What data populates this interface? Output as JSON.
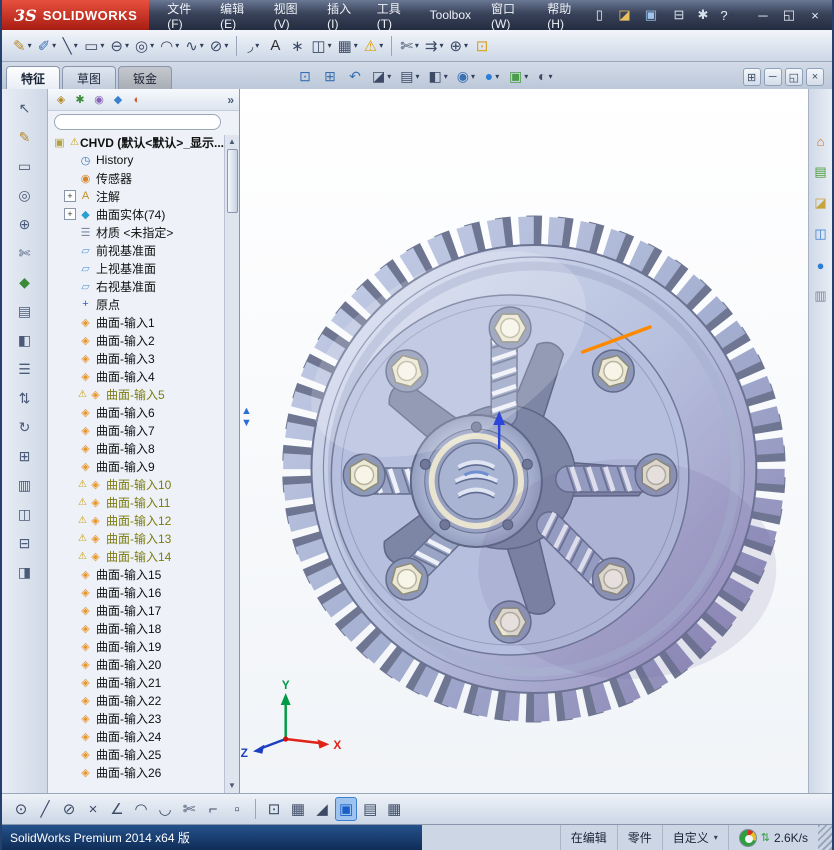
{
  "window": {
    "logo_mark": "3S",
    "logo_text": "SOLIDWORKS"
  },
  "menubar": {
    "items": [
      {
        "name": "menu-file",
        "label": "文件(F)"
      },
      {
        "name": "menu-edit",
        "label": "编辑(E)"
      },
      {
        "name": "menu-view",
        "label": "视图(V)"
      },
      {
        "name": "menu-insert",
        "label": "插入(I)"
      },
      {
        "name": "menu-tools",
        "label": "工具(T)"
      },
      {
        "name": "menu-toolbox",
        "label": "Toolbox"
      },
      {
        "name": "menu-window",
        "label": "窗口(W)"
      },
      {
        "name": "menu-help",
        "label": "帮助(H)"
      }
    ],
    "quick_icons": [
      {
        "name": "new-document-icon",
        "glyph": "▯",
        "caret": true
      },
      {
        "name": "open-icon",
        "glyph": "◪",
        "color": "#e8c060",
        "caret": true
      },
      {
        "name": "save-icon",
        "glyph": "▣",
        "color": "#9ec4ee",
        "caret": true
      },
      {
        "name": "print-icon",
        "glyph": "⊟",
        "color": "#d8e0ec"
      },
      {
        "name": "options-icon",
        "glyph": "✱",
        "color": "#d8e0ec"
      },
      {
        "name": "help-icon",
        "glyph": "?",
        "caret": true
      }
    ],
    "window_icons": [
      {
        "name": "minimize-button",
        "glyph": "─"
      },
      {
        "name": "restore-button",
        "glyph": "◱"
      },
      {
        "name": "close-button",
        "glyph": "×"
      }
    ]
  },
  "sketch_toolbar": [
    {
      "name": "sketch-icon",
      "glyph": "✎",
      "color": "#b5882a",
      "caret": true
    },
    {
      "name": "smart-dimension-icon",
      "glyph": "✐",
      "color": "#3a6fb0",
      "caret": true
    },
    {
      "name": "line-icon",
      "glyph": "╲",
      "caret": true
    },
    {
      "name": "rectangle-icon",
      "glyph": "▭",
      "caret": true
    },
    {
      "name": "slot-icon",
      "glyph": "⊖",
      "caret": true
    },
    {
      "name": "circle-icon",
      "glyph": "◎",
      "caret": true
    },
    {
      "name": "arc-icon",
      "glyph": "◠",
      "caret": true
    },
    {
      "name": "spline-icon",
      "glyph": "∿",
      "caret": true
    },
    {
      "name": "ellipse-icon",
      "glyph": "⊘",
      "caret": true
    },
    {
      "sep": true
    },
    {
      "name": "sketch-fillet-icon",
      "glyph": "◞",
      "caret": true
    },
    {
      "name": "text-icon",
      "glyph": "A",
      "color": "#303030"
    },
    {
      "name": "point-icon",
      "glyph": "∗"
    },
    {
      "name": "mirror-entities-icon",
      "glyph": "◫",
      "caret": true
    },
    {
      "name": "linear-pattern-icon",
      "glyph": "▦",
      "caret": true
    },
    {
      "name": "display-relations-icon",
      "glyph": "⚠",
      "color": "#d8a000",
      "caret": true
    },
    {
      "sep": true
    },
    {
      "name": "trim-entities-icon",
      "glyph": "✄",
      "caret": true
    },
    {
      "name": "offset-entities-icon",
      "glyph": "⇉",
      "caret": true
    },
    {
      "name": "convert-entities-icon",
      "glyph": "⊕",
      "caret": true
    },
    {
      "name": "instant2d-icon",
      "glyph": "⊡",
      "color": "#d8a020"
    }
  ],
  "command_tabs": [
    {
      "name": "tab-features",
      "label": "特征",
      "active": true
    },
    {
      "name": "tab-sketch",
      "label": "草图"
    },
    {
      "name": "tab-sheet-metal",
      "label": "钣金",
      "variant": "dark"
    }
  ],
  "hud_toolbar": [
    {
      "name": "zoom-fit-icon",
      "glyph": "⊡",
      "color": "#3a6fb0"
    },
    {
      "name": "zoom-to-area-icon",
      "glyph": "⊞",
      "color": "#3a6fb0"
    },
    {
      "name": "previous-view-icon",
      "glyph": "↶",
      "color": "#3a6fb0"
    },
    {
      "name": "section-view-icon",
      "glyph": "◪",
      "caret": true
    },
    {
      "name": "view-orientation-icon",
      "glyph": "▤",
      "caret": true
    },
    {
      "name": "display-style-icon",
      "glyph": "◧",
      "caret": true
    },
    {
      "name": "hide-show-items-icon",
      "glyph": "◉",
      "color": "#3a6fb0",
      "caret": true
    },
    {
      "name": "edit-appearance-icon",
      "glyph": "●",
      "color": "#2a7fd8",
      "caret": true
    },
    {
      "name": "apply-scene-icon",
      "glyph": "▣",
      "color": "#4a9e4a",
      "caret": true
    },
    {
      "name": "view-settings-icon",
      "glyph": "◐",
      "caret": true
    }
  ],
  "doc_window_icons": [
    {
      "name": "tile-windows-icon",
      "glyph": "⊞"
    },
    {
      "name": "doc-minimize-icon",
      "glyph": "─"
    },
    {
      "name": "doc-restore-icon",
      "glyph": "◱"
    },
    {
      "name": "doc-close-icon",
      "glyph": "×"
    }
  ],
  "left_toolbar": [
    {
      "name": "left-toolbar-icon",
      "glyph": "↖"
    },
    {
      "name": "left-toolbar-icon",
      "glyph": "✎",
      "color": "#b5882a"
    },
    {
      "name": "left-toolbar-icon",
      "glyph": "▭"
    },
    {
      "name": "left-toolbar-icon",
      "glyph": "◎"
    },
    {
      "name": "left-toolbar-icon",
      "glyph": "⊕"
    },
    {
      "name": "left-toolbar-icon",
      "glyph": "✄"
    },
    {
      "name": "left-toolbar-icon",
      "glyph": "◆",
      "color": "#3a8a3a"
    },
    {
      "name": "left-toolbar-icon",
      "glyph": "▤"
    },
    {
      "name": "left-toolbar-icon",
      "glyph": "◧"
    },
    {
      "name": "left-toolbar-icon",
      "glyph": "☰"
    },
    {
      "name": "left-toolbar-icon",
      "glyph": "⇅"
    },
    {
      "name": "left-toolbar-icon",
      "glyph": "↻"
    },
    {
      "name": "left-toolbar-icon",
      "glyph": "⊞"
    },
    {
      "name": "left-toolbar-icon",
      "glyph": "▥"
    },
    {
      "name": "left-toolbar-icon",
      "glyph": "◫"
    },
    {
      "name": "left-toolbar-icon",
      "glyph": "⊟"
    },
    {
      "name": "left-toolbar-icon",
      "glyph": "◨"
    }
  ],
  "tree_tabs": [
    {
      "name": "featuremanager-tab-icon",
      "glyph": "◈",
      "color": "#b5892a"
    },
    {
      "name": "propertymanager-tab-icon",
      "glyph": "✱",
      "color": "#3a8a3a"
    },
    {
      "name": "configurationmanager-tab-icon",
      "glyph": "◉",
      "color": "#8a62b8"
    },
    {
      "name": "dimxpert-tab-icon",
      "glyph": "◆",
      "color": "#3a7fd0"
    },
    {
      "name": "displaymanager-tab-icon",
      "glyph": "◐",
      "color": "#d05a3a"
    }
  ],
  "tree": {
    "root_label": "CHVD (默认<默认>_显示...",
    "expand_chevrons": "»",
    "icon_glyphs": {
      "part": {
        "glyph": "▣",
        "color": "#b5a23c"
      },
      "warning": {
        "glyph": "⚠",
        "color": "#c89b00"
      },
      "history": {
        "glyph": "◷",
        "color": "#3a6fb0"
      },
      "sensors": {
        "glyph": "◉",
        "color": "#d8842a"
      },
      "annotations": {
        "glyph": "A",
        "color": "#c09020"
      },
      "surface-bodies": {
        "glyph": "◆",
        "color": "#2a9fd0"
      },
      "material": {
        "glyph": "☰",
        "color": "#7a8aa0"
      },
      "plane": {
        "glyph": "▱",
        "color": "#5a9ad8"
      },
      "origin": {
        "glyph": "+",
        "color": "#2a5fd0"
      },
      "surface-import": {
        "glyph": "◈",
        "color": "#e8952a"
      }
    },
    "items": [
      {
        "icon": "history",
        "label": "History"
      },
      {
        "icon": "sensors",
        "label": "传感器"
      },
      {
        "icon": "annotations",
        "label": "注解",
        "expand": true
      },
      {
        "icon": "surface-bodies",
        "label": "曲面实体(74)",
        "expand": true
      },
      {
        "icon": "material",
        "label": "材质 <未指定>"
      },
      {
        "icon": "plane",
        "label": "前视基准面"
      },
      {
        "icon": "plane",
        "label": "上视基准面"
      },
      {
        "icon": "plane",
        "label": "右视基准面"
      },
      {
        "icon": "origin",
        "label": "原点"
      },
      {
        "icon": "surface-import",
        "label": "曲面-输入1"
      },
      {
        "icon": "surface-import",
        "label": "曲面-输入2"
      },
      {
        "icon": "surface-import",
        "label": "曲面-输入3"
      },
      {
        "icon": "surface-import",
        "label": "曲面-输入4"
      },
      {
        "icon": "surface-import",
        "label": "曲面-输入5",
        "warning": true
      },
      {
        "icon": "surface-import",
        "label": "曲面-输入6"
      },
      {
        "icon": "surface-import",
        "label": "曲面-输入7"
      },
      {
        "icon": "surface-import",
        "label": "曲面-输入8"
      },
      {
        "icon": "surface-import",
        "label": "曲面-输入9"
      },
      {
        "icon": "surface-import",
        "label": "曲面-输入10",
        "warning": true
      },
      {
        "icon": "surface-import",
        "label": "曲面-输入11",
        "warning": true
      },
      {
        "icon": "surface-import",
        "label": "曲面-输入12",
        "warning": true
      },
      {
        "icon": "surface-import",
        "label": "曲面-输入13",
        "warning": true
      },
      {
        "icon": "surface-import",
        "label": "曲面-输入14",
        "warning": true
      },
      {
        "icon": "surface-import",
        "label": "曲面-输入15"
      },
      {
        "icon": "surface-import",
        "label": "曲面-输入16"
      },
      {
        "icon": "surface-import",
        "label": "曲面-输入17"
      },
      {
        "icon": "surface-import",
        "label": "曲面-输入18"
      },
      {
        "icon": "surface-import",
        "label": "曲面-输入19"
      },
      {
        "icon": "surface-import",
        "label": "曲面-输入20"
      },
      {
        "icon": "surface-import",
        "label": "曲面-输入21"
      },
      {
        "icon": "surface-import",
        "label": "曲面-输入22"
      },
      {
        "icon": "surface-import",
        "label": "曲面-输入23"
      },
      {
        "icon": "surface-import",
        "label": "曲面-输入24"
      },
      {
        "icon": "surface-import",
        "label": "曲面-输入25"
      },
      {
        "icon": "surface-import",
        "label": "曲面-输入26"
      }
    ]
  },
  "task_pane_icons": [
    {
      "name": "home-icon",
      "glyph": "⌂",
      "color": "#d07020"
    },
    {
      "name": "design-library-icon",
      "glyph": "▤",
      "color": "#4a9e3a"
    },
    {
      "name": "file-explorer-icon",
      "glyph": "◪",
      "color": "#c8a23a"
    },
    {
      "name": "view-palette-icon",
      "glyph": "◫",
      "color": "#3a7fd0"
    },
    {
      "name": "appearances-icon",
      "glyph": "●",
      "color": "#2a7fd8"
    },
    {
      "name": "custom-properties-icon",
      "glyph": "▥",
      "color": "#808898"
    }
  ],
  "snap_toolbar": [
    {
      "name": "snap-point-icon",
      "glyph": "⊙"
    },
    {
      "name": "snap-line-icon",
      "glyph": "╱"
    },
    {
      "name": "snap-center-icon",
      "glyph": "⊘"
    },
    {
      "name": "snap-intersection-icon",
      "glyph": "×"
    },
    {
      "name": "snap-angle-icon",
      "glyph": "∠"
    },
    {
      "name": "snap-arc-icon",
      "glyph": "◠"
    },
    {
      "name": "snap-tangent-icon",
      "glyph": "◡"
    },
    {
      "name": "snap-trim-icon",
      "glyph": "✄"
    },
    {
      "name": "snap-corner-icon",
      "glyph": "⌐"
    },
    {
      "name": "snap-box-icon",
      "glyph": "▫"
    },
    {
      "sep": true
    },
    {
      "name": "grid-settings-icon",
      "glyph": "⊡"
    },
    {
      "name": "grid-icon",
      "glyph": "▦"
    },
    {
      "name": "angle-snap-icon",
      "glyph": "◢"
    },
    {
      "name": "shaded-sketch-icon",
      "glyph": "▣",
      "color": "#1a5fc8",
      "active": true
    },
    {
      "name": "planes-list-icon",
      "glyph": "▤"
    },
    {
      "name": "table-icon",
      "glyph": "▦"
    }
  ],
  "viewport": {
    "triad": {
      "x": "X",
      "y": "Y",
      "z": "Z"
    }
  },
  "statusbar": {
    "app_version": "SolidWorks Premium 2014 x64 版",
    "editing": "在编辑",
    "doc_type": "零件",
    "custom": "自定义",
    "net_speed": "2.6K/s"
  }
}
